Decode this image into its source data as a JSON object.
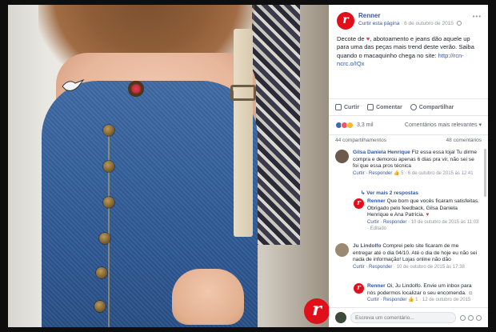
{
  "colors": {
    "brand": "#e10f1a",
    "link": "#365899",
    "like": "#4267b2",
    "love": "#f25268",
    "muted": "#90949c"
  },
  "photo": {
    "logo_letter": "r"
  },
  "post": {
    "avatar_letter": "r",
    "page_name": "Renner",
    "like_page": "Curtir esta página",
    "separator": "·",
    "date": "6 de outubro de 2015",
    "privacy_icon": "globe-icon",
    "more_icon": "•••",
    "text_part1": "Decote de ",
    "heart": "♥",
    "text_part2": ", abotoamento e jeans dão aquele up para uma das peças mais trend deste verão. Saiba quando o macaquinho chega no site: ",
    "link": "http://rcn-ncrc.o/IQx"
  },
  "actions": {
    "like": "Curtir",
    "comment": "Comentar",
    "share": "Compartilhar"
  },
  "reactions": {
    "count": "3,3 mil",
    "relevant": "Comentários mais relevantes ▾"
  },
  "stats": {
    "shares": "44 compartilhamentos",
    "comments": "48 comentários"
  },
  "comments": [
    {
      "author": "Gilsa Daniela Henrique",
      "text": "Fiz essa essa lojal Tu dirme compra e demorou apenas 6 dias pra vir, não sei se foi que essa pros técnica",
      "actions": "Curtir · Responder",
      "likes": "5",
      "date": "6 de outubro de 2015 às 12:41"
    },
    {
      "reply_link": "↳ Ver mais 2 respostas"
    },
    {
      "author": "Renner",
      "text": "Que bom que vocês ficaram satisfeitas. Obrigado pelo feedback, Gilsa Daniela Henrique e Ana Patrícia.",
      "heart": "♥",
      "actions": "Curtir · Responder",
      "date": "10 de outubro de 2015 às 11:03",
      "edited": "Editado"
    },
    {
      "author": "Ju Lindolfo",
      "text": "Comprei pelo site ficaram de me entregar até o dia 04/10. Até o dia de hoje eu não sei nada de informação! Lojas online não dão",
      "actions": "Curtir · Responder",
      "date": "10 de outubro de 2015 às 17:38"
    },
    {
      "author": "Renner",
      "text": "Oi, Ju Lindolfo. Envie um inbox para nós podermos localizar o seu encomenda.",
      "emoji": "☺",
      "actions": "Curtir · Responder",
      "likes": "1",
      "date": "12 de outubro de 2015"
    }
  ],
  "write": {
    "placeholder": "Escreva um comentário..."
  }
}
